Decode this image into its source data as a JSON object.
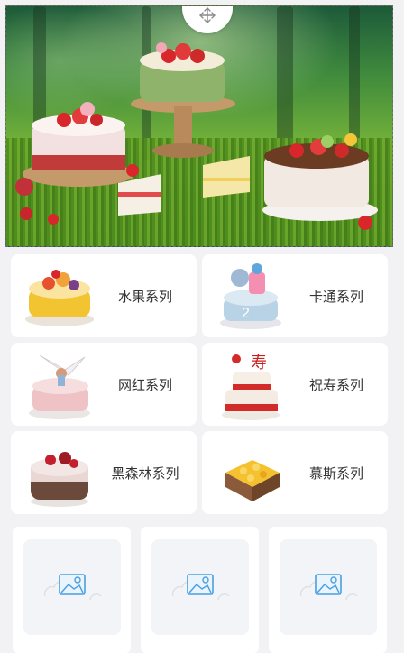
{
  "banner": {
    "alt": "cakes on moss in a forest",
    "move_icon": "move-arrows-icon"
  },
  "categories": [
    {
      "label": "水果系列",
      "icon": "fruit-cake"
    },
    {
      "label": "卡通系列",
      "icon": "cartoon-cake"
    },
    {
      "label": "网红系列",
      "icon": "trendy-cake"
    },
    {
      "label": "祝寿系列",
      "icon": "birthday-longevity-cake"
    },
    {
      "label": "黑森林系列",
      "icon": "black-forest-cake"
    },
    {
      "label": "慕斯系列",
      "icon": "mousse-cake"
    }
  ],
  "placeholders": [
    {
      "icon": "image-placeholder-icon"
    },
    {
      "icon": "image-placeholder-icon"
    },
    {
      "icon": "image-placeholder-icon"
    }
  ],
  "colors": {
    "page_bg": "#f2f2f4",
    "card_bg": "#ffffff",
    "text": "#333333",
    "placeholder_icon": "#4a9fe0"
  }
}
